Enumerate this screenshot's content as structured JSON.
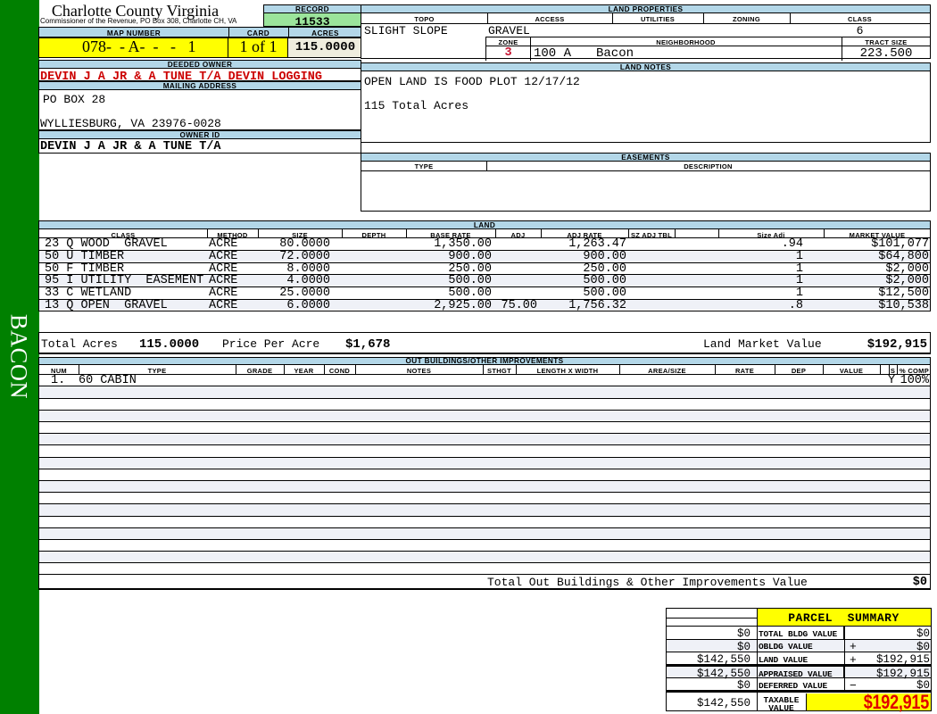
{
  "sidebar": {
    "label": "BACON"
  },
  "header": {
    "county_title": "Charlotte County Virginia",
    "county_subtitle": "Commissioner of the Revenue, PO Box 308, Charlotte CH, VA",
    "record_label": "RECORD",
    "record_value": "11533",
    "map_number_label": "MAP NUMBER",
    "map_number_value": "078-  - A-  -   -   1",
    "card_label": "CARD",
    "card_value": "1 of 1",
    "acres_label": "ACRES",
    "acres_value": "115.0000",
    "deeded_owner_label": "DEEDED OWNER",
    "deeded_owner_value": "DEVIN J A JR & A TUNE T/A DEVIN LOGGING",
    "mailing_address_label": "MAILING ADDRESS",
    "mailing_address_line1": "PO BOX 28",
    "mailing_address_line2": "WYLLIESBURG, VA 23976-0028",
    "owner_id_label": "OWNER ID",
    "owner_id_value": "DEVIN J A JR & A TUNE T/A"
  },
  "land_properties": {
    "title": "LAND PROPERTIES",
    "topo_label": "TOPO",
    "topo": "SLIGHT SLOPE",
    "access_label": "ACCESS",
    "access": "GRAVEL",
    "utilities_label": "UTILITIES",
    "utilities": "",
    "zoning_label": "ZONING",
    "zoning": "",
    "class_label": "CLASS",
    "class": "6",
    "zone_label": "ZONE",
    "zone": "3",
    "neighborhood_label": "NEIGHBORHOOD",
    "neighborhood_code": "100 A",
    "neighborhood_name": "Bacon",
    "tract_size_label": "TRACT SIZE",
    "tract_size": "223.500"
  },
  "land_notes": {
    "title": "LAND NOTES",
    "line1": "OPEN LAND IS FOOD PLOT 12/17/12",
    "line2": "115 Total Acres"
  },
  "easements": {
    "title": "EASEMENTS",
    "type_label": "TYPE",
    "description_label": "DESCRIPTION"
  },
  "land": {
    "title": "LAND",
    "col_class": "CLASS",
    "col_method": "METHOD",
    "col_size": "SIZE",
    "col_depth": "DEPTH",
    "col_base_rate": "BASE RATE",
    "col_adj": "ADJ",
    "col_adj_rate": "ADJ RATE",
    "col_sz_adj_tbl": "SZ ADJ TBL",
    "col_size_adj": "Size Adj",
    "col_market_value": "MARKET VALUE",
    "rows": [
      {
        "class": "23 Q WOOD  GRAVEL",
        "method": "ACRE",
        "size": "80.0000",
        "depth": "",
        "base_rate": "1,350.00",
        "adj": "",
        "adj_rate": "1,263.47",
        "sz_adj_tbl": "",
        "size_adj": ".94",
        "market_value": "$101,077"
      },
      {
        "class": "50 U TIMBER",
        "method": "ACRE",
        "size": "72.0000",
        "depth": "",
        "base_rate": "900.00",
        "adj": "",
        "adj_rate": "900.00",
        "sz_adj_tbl": "",
        "size_adj": "1",
        "market_value": "$64,800"
      },
      {
        "class": "50 F TIMBER",
        "method": "ACRE",
        "size": "8.0000",
        "depth": "",
        "base_rate": "250.00",
        "adj": "",
        "adj_rate": "250.00",
        "sz_adj_tbl": "",
        "size_adj": "1",
        "market_value": "$2,000"
      },
      {
        "class": "95 I UTILITY  EASEMENT",
        "method": "ACRE",
        "size": "4.0000",
        "depth": "",
        "base_rate": "500.00",
        "adj": "",
        "adj_rate": "500.00",
        "sz_adj_tbl": "",
        "size_adj": "1",
        "market_value": "$2,000"
      },
      {
        "class": "33 C WETLAND",
        "method": "ACRE",
        "size": "25.0000",
        "depth": "",
        "base_rate": "500.00",
        "adj": "",
        "adj_rate": "500.00",
        "sz_adj_tbl": "",
        "size_adj": "1",
        "market_value": "$12,500"
      },
      {
        "class": "13 Q OPEN  GRAVEL",
        "method": "ACRE",
        "size": "6.0000",
        "depth": "",
        "base_rate": "2,925.00",
        "adj": "75.00",
        "adj_rate": "1,756.32",
        "sz_adj_tbl": "",
        "size_adj": ".8",
        "market_value": "$10,538"
      }
    ],
    "total_acres_label": "Total Acres",
    "total_acres": "115.0000",
    "price_per_acre_label": "Price Per Acre",
    "price_per_acre": "$1,678",
    "land_market_value_label": "Land Market Value",
    "land_market_value": "$192,915"
  },
  "out_buildings": {
    "title": "OUT BUILDINGS/OTHER IMPROVEMENTS",
    "col_num": "NUM",
    "col_type": "TYPE",
    "col_grade": "GRADE",
    "col_year": "YEAR",
    "col_cond": "COND",
    "col_notes": "NOTES",
    "col_sthgt": "STHGT",
    "col_length_width": "LENGTH X WIDTH",
    "col_area_size": "AREA/SIZE",
    "col_rate": "RATE",
    "col_dep": "DEP",
    "col_value": "VALUE",
    "col_s": "S",
    "col_pct_comp": "% COMP",
    "row1": {
      "num": "1.",
      "type": "60 CABIN",
      "s": "Y",
      "pct_comp": "100%"
    },
    "total_label": "Total Out Buildings & Other Improvements Value",
    "total_value": "$0"
  },
  "parcel_summary": {
    "title": "PARCEL  SUMMARY",
    "rows": [
      {
        "prior": "$0",
        "label": "TOTAL BLDG VALUE",
        "sign": "",
        "value": "$0"
      },
      {
        "prior": "$0",
        "label": "OBLDG VALUE",
        "sign": "+",
        "value": "$0"
      },
      {
        "prior": "$142,550",
        "label": "LAND VALUE",
        "sign": "+",
        "value": "$192,915"
      },
      {
        "prior": "$142,550",
        "label": "APPRAISED VALUE",
        "sign": "",
        "value": "$192,915"
      },
      {
        "prior": "$0",
        "label": "DEFERRED VALUE",
        "sign": "−",
        "value": "$0"
      },
      {
        "prior": "$142,550",
        "label_line1": "TAXABLE",
        "label_line2": "VALUE",
        "value": "$192,915"
      }
    ]
  }
}
